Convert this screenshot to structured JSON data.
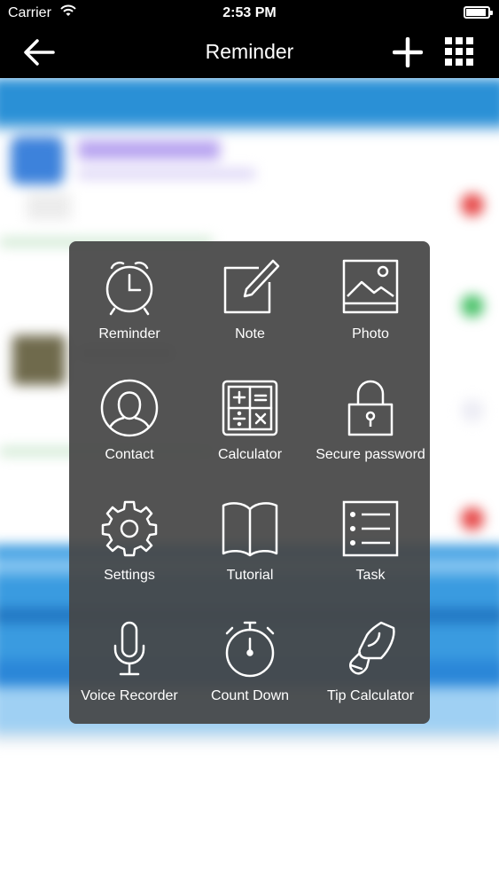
{
  "status_bar": {
    "carrier": "Carrier",
    "time": "2:53 PM"
  },
  "nav": {
    "title": "Reminder"
  },
  "menu": {
    "items": [
      {
        "label": "Reminder",
        "icon": "alarm-clock-icon"
      },
      {
        "label": "Note",
        "icon": "note-edit-icon"
      },
      {
        "label": "Photo",
        "icon": "photo-icon"
      },
      {
        "label": "Contact",
        "icon": "contact-icon"
      },
      {
        "label": "Calculator",
        "icon": "calculator-icon"
      },
      {
        "label": "Secure password",
        "icon": "lock-icon"
      },
      {
        "label": "Settings",
        "icon": "gear-icon"
      },
      {
        "label": "Tutorial",
        "icon": "book-icon"
      },
      {
        "label": "Task",
        "icon": "task-list-icon"
      },
      {
        "label": "Voice Recorder",
        "icon": "microphone-icon"
      },
      {
        "label": "Count Down",
        "icon": "stopwatch-icon"
      },
      {
        "label": "Tip Calculator",
        "icon": "tip-hand-icon"
      }
    ]
  },
  "colors": {
    "bar": "#000000",
    "accent": "#2a90d6",
    "overlay": "#464646"
  }
}
